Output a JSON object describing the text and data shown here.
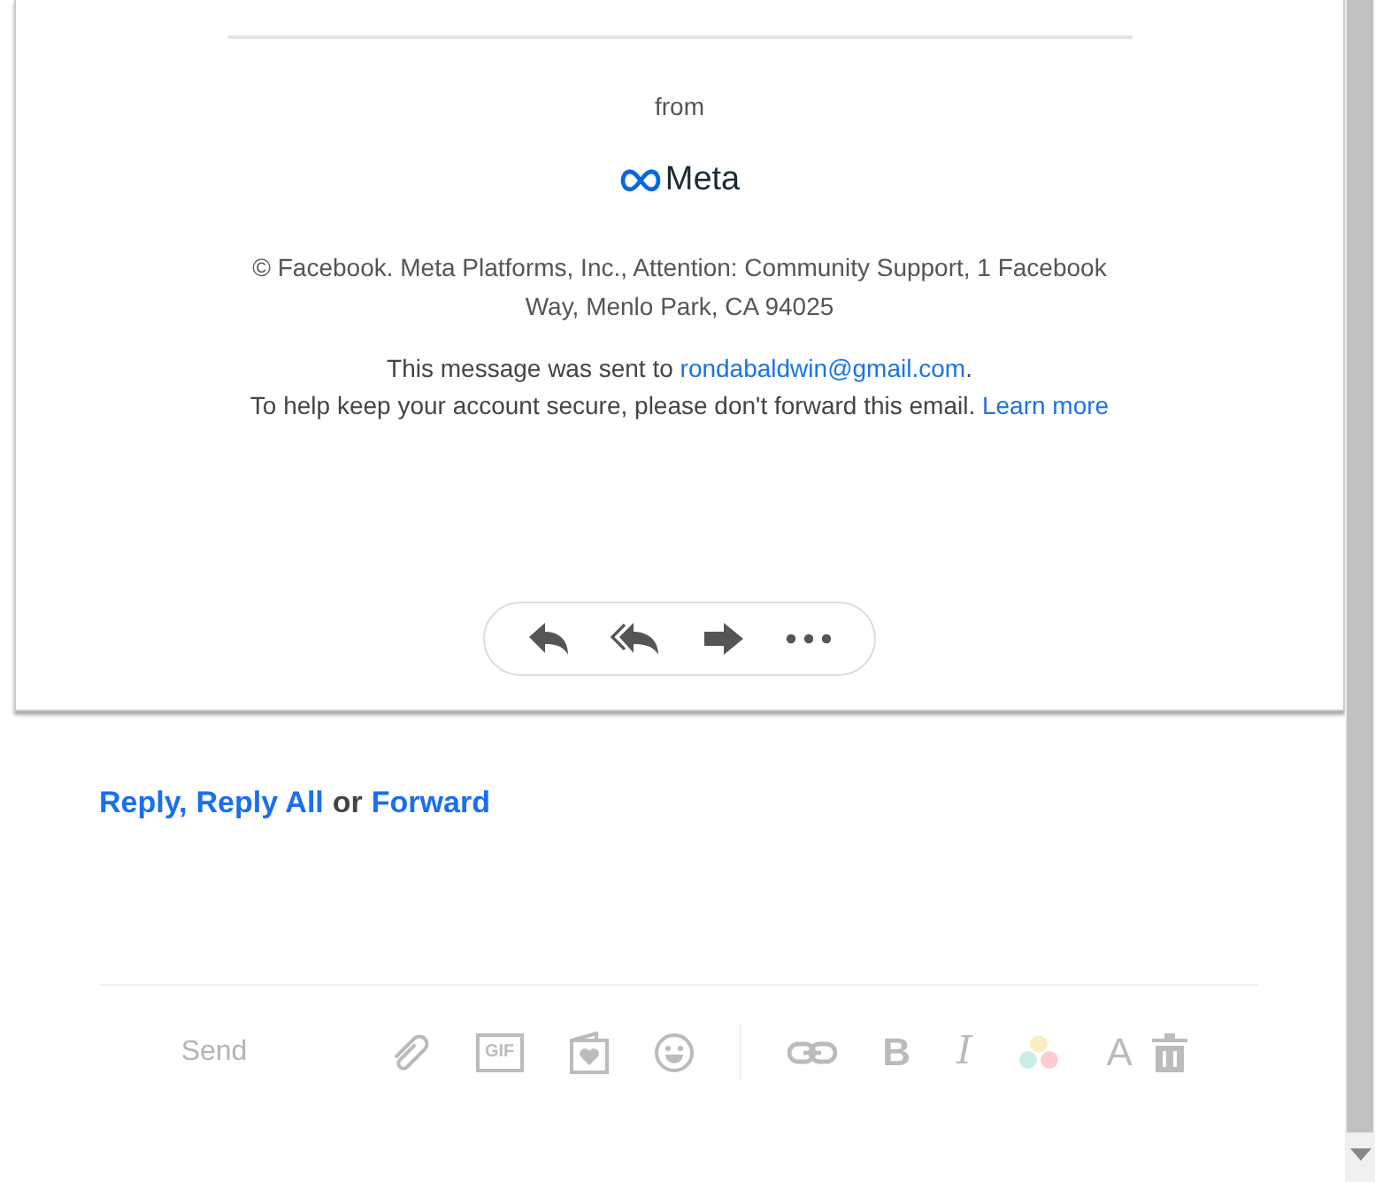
{
  "email": {
    "from_label": "from",
    "brand": "Meta",
    "address": "© Facebook. Meta Platforms, Inc., Attention: Community Support, 1 Facebook Way, Menlo Park, CA 94025",
    "sent_prefix": "This message was sent to ",
    "sent_email": "rondabaldwin@gmail.com",
    "sent_suffix": ".",
    "security_note": "To help keep your account secure, please don't forward this email. ",
    "learn_more": "Learn more"
  },
  "action_pill": [
    {
      "kind": "reply"
    },
    {
      "kind": "reply_all"
    },
    {
      "kind": "forward"
    },
    {
      "kind": "more"
    }
  ],
  "quick_reply": {
    "reply": "Reply",
    "comma": ",",
    "reply_all": "Reply All",
    "or": "or",
    "forward": "Forward"
  },
  "composer": {
    "send": "Send",
    "send_disabled": true,
    "tools": [
      {
        "kind": "attach"
      },
      {
        "kind": "gif",
        "text": "GIF"
      },
      {
        "kind": "sticker"
      },
      {
        "kind": "emoji"
      },
      {
        "kind": "divider"
      },
      {
        "kind": "link"
      },
      {
        "kind": "bold",
        "text": "B"
      },
      {
        "kind": "italic",
        "text": "I"
      },
      {
        "kind": "colors"
      },
      {
        "kind": "font",
        "text": "A"
      },
      {
        "kind": "delete"
      }
    ]
  }
}
